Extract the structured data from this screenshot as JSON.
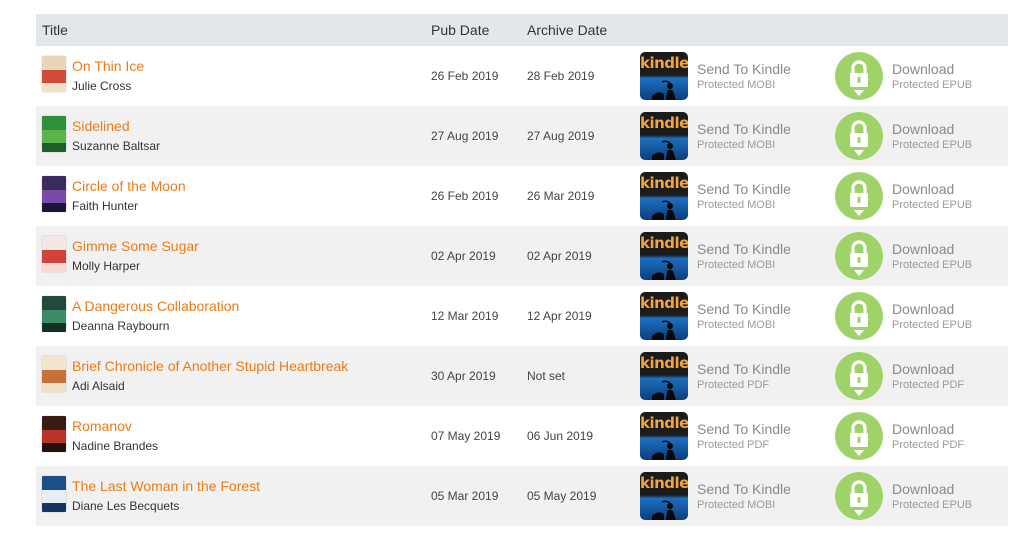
{
  "header": {
    "title": "Title",
    "pub_date": "Pub Date",
    "archive_date": "Archive Date"
  },
  "kindle_label": "Send To Kindle",
  "kindle_logo_text": "kindle",
  "download_label": "Download",
  "colors": {
    "title_link": "#ef7a16",
    "download_green": "#9fd36a",
    "header_bg": "#e4e7ea",
    "row_alt_bg": "#f1f1f1"
  },
  "rows": [
    {
      "title": "On Thin Ice",
      "author": "Julie Cross",
      "pub": "26 Feb 2019",
      "archive": "28 Feb 2019",
      "kindle_format": "Protected MOBI",
      "download_format": "Protected EPUB",
      "cover": [
        "#e9d6b8",
        "#d14a3a",
        "#f0e2c6"
      ]
    },
    {
      "title": "Sidelined",
      "author": "Suzanne Baltsar",
      "pub": "27 Aug 2019",
      "archive": "27 Aug 2019",
      "kindle_format": "Protected MOBI",
      "download_format": "Protected EPUB",
      "cover": [
        "#2f8f3a",
        "#5ab44a",
        "#1e5e28"
      ]
    },
    {
      "title": "Circle of the Moon",
      "author": "Faith Hunter",
      "pub": "26 Feb 2019",
      "archive": "26 Mar 2019",
      "kindle_format": "Protected MOBI",
      "download_format": "Protected EPUB",
      "cover": [
        "#3a2a5e",
        "#7a4aa8",
        "#1c1436"
      ]
    },
    {
      "title": "Gimme Some Sugar",
      "author": "Molly Harper",
      "pub": "02 Apr 2019",
      "archive": "02 Apr 2019",
      "kindle_format": "Protected MOBI",
      "download_format": "Protected EPUB",
      "cover": [
        "#f4e8e6",
        "#d2423a",
        "#f8d8d0"
      ]
    },
    {
      "title": "A Dangerous Collaboration",
      "author": "Deanna Raybourn",
      "pub": "12 Mar 2019",
      "archive": "12 Apr 2019",
      "kindle_format": "Protected MOBI",
      "download_format": "Protected EPUB",
      "cover": [
        "#1f4a3a",
        "#3f8a68",
        "#143024"
      ]
    },
    {
      "title": "Brief Chronicle of Another Stupid Heartbreak",
      "author": "Adi Alsaid",
      "pub": "30 Apr 2019",
      "archive": "Not set",
      "kindle_format": "Protected PDF",
      "download_format": "Protected PDF",
      "cover": [
        "#f2e6d0",
        "#c8703a",
        "#efe0c4"
      ]
    },
    {
      "title": "Romanov",
      "author": "Nadine Brandes",
      "pub": "07 May 2019",
      "archive": "06 Jun 2019",
      "kindle_format": "Protected PDF",
      "download_format": "Protected PDF",
      "cover": [
        "#3a1a14",
        "#b8342a",
        "#26100c"
      ]
    },
    {
      "title": "The Last Woman in the Forest",
      "author": "Diane Les Becquets",
      "pub": "05 Mar 2019",
      "archive": "05 May 2019",
      "kindle_format": "Protected MOBI",
      "download_format": "Protected EPUB",
      "cover": [
        "#1c4f86",
        "#e8eef4",
        "#13365e"
      ]
    }
  ]
}
